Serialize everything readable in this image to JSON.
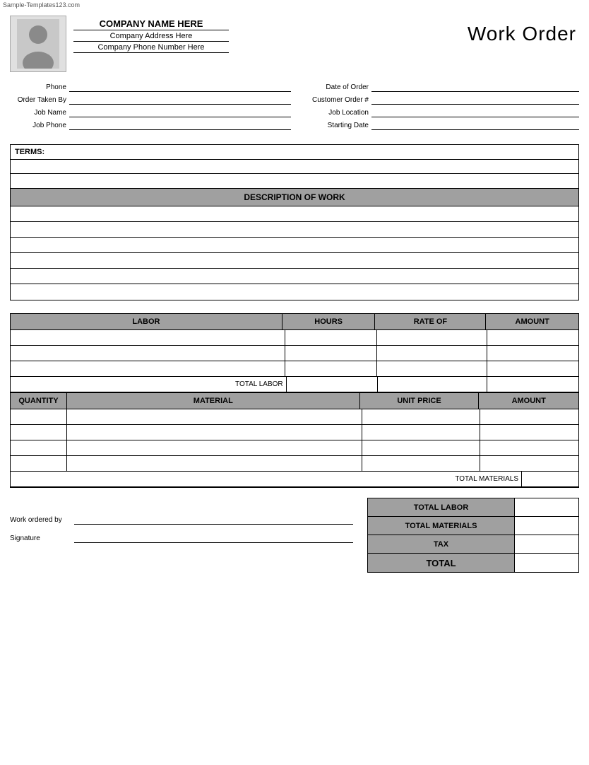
{
  "watermark": "Sample-Templates123.com",
  "header": {
    "company_name": "COMPANY NAME HERE",
    "company_address": "Company Address Here",
    "company_phone": "Company Phone Number Here",
    "title": "Work Order"
  },
  "form_fields": {
    "phone_label": "Phone",
    "date_of_order_label": "Date of Order",
    "order_taken_by_label": "Order Taken By",
    "customer_order_label": "Customer Order #",
    "job_name_label": "Job Name",
    "job_location_label": "Job Location",
    "job_phone_label": "Job Phone",
    "starting_date_label": "Starting Date"
  },
  "terms": {
    "label": "TERMS:"
  },
  "description": {
    "header": "DESCRIPTION OF WORK",
    "rows": 6
  },
  "labor": {
    "header_labor": "LABOR",
    "header_hours": "HOURS",
    "header_rate": "RATE OF",
    "header_amount": "AMOUNT",
    "total_labor_label": "TOTAL LABOR",
    "rows": 3
  },
  "materials": {
    "header_qty": "QUANTITY",
    "header_material": "MATERIAL",
    "header_unit": "UNIT PRICE",
    "header_amount": "AMOUNT",
    "total_materials_label": "TOTAL MATERIALS",
    "rows": 4
  },
  "summary": {
    "total_labor_label": "TOTAL LABOR",
    "total_materials_label": "TOTAL MATERIALS",
    "tax_label": "TAX",
    "total_label": "TOTAL"
  },
  "signature": {
    "work_ordered_by_label": "Work ordered by",
    "signature_label": "Signature"
  }
}
